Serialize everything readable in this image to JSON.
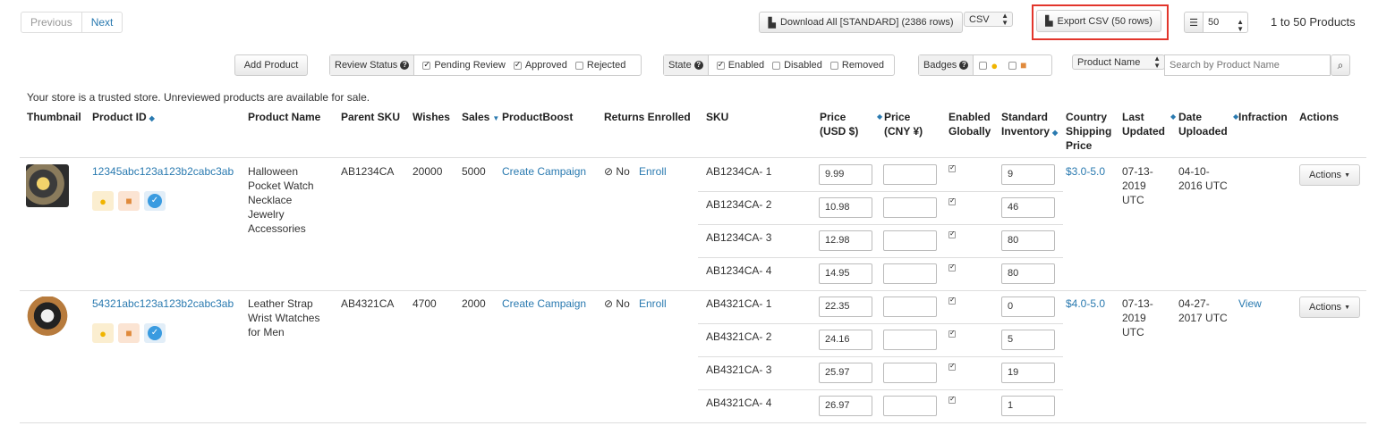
{
  "pager": {
    "previous": "Previous",
    "next": "Next"
  },
  "toolbar": {
    "download_all": "Download All [STANDARD] (2386 rows)",
    "format": "CSV",
    "export_csv": "Export CSV (50 rows)",
    "per_page": "50",
    "range_text": "1 to 50 Products",
    "highlight_color": "#e2352b"
  },
  "filters": {
    "add_product": "Add Product",
    "review_status": {
      "label": "Review Status",
      "options": [
        "Pending Review",
        "Approved",
        "Rejected"
      ],
      "checked": [
        true,
        true,
        false
      ]
    },
    "state": {
      "label": "State",
      "options": [
        "Enabled",
        "Disabled",
        "Removed"
      ],
      "checked": [
        true,
        false,
        false
      ]
    },
    "badges": {
      "label": "Badges"
    },
    "search_field": "Product Name",
    "search_placeholder": "Search by Product Name"
  },
  "notice": "Your store is a trusted store. Unreviewed products are available for sale.",
  "columns": {
    "thumbnail": "Thumbnail",
    "product_id": "Product ID",
    "product_name": "Product Name",
    "parent_sku": "Parent SKU",
    "wishes": "Wishes",
    "sales": "Sales",
    "productboost": "ProductBoost",
    "returns": "Returns Enrolled",
    "sku": "SKU",
    "price_usd_1": "Price",
    "price_usd_2": "(USD $)",
    "price_cny_1": "Price",
    "price_cny_2": "(CNY ¥)",
    "enabled_1": "Enabled",
    "enabled_2": "Globally",
    "inventory_1": "Standard",
    "inventory_2": "Inventory",
    "shipping_1": "Country",
    "shipping_2": "Shipping",
    "shipping_3": "Price",
    "updated_1": "Last",
    "updated_2": "Updated",
    "uploaded_1": "Date",
    "uploaded_2": "Uploaded",
    "infraction": "Infraction",
    "actions": "Actions"
  },
  "products": [
    {
      "id": "12345abc123a123b2cabc3ab",
      "name_lines": [
        "Halloween",
        "Pocket Watch",
        "Necklace",
        "Jewelry",
        "Accessories"
      ],
      "parent_sku": "AB1234CA",
      "wishes": "20000",
      "sales": "5000",
      "boost": "Create Campaign",
      "returns": "No",
      "enroll": "Enroll",
      "shipping": "$3.0-5.0",
      "updated": [
        "07-13-",
        "2019",
        "UTC"
      ],
      "uploaded": [
        "04-10-",
        "2016 UTC"
      ],
      "infraction": "",
      "actions": "Actions",
      "variants": [
        {
          "sku": "AB1234CA- 1",
          "price": "9.99",
          "inventory": "9"
        },
        {
          "sku": "AB1234CA- 2",
          "price": "10.98",
          "inventory": "46"
        },
        {
          "sku": "AB1234CA- 3",
          "price": "12.98",
          "inventory": "80"
        },
        {
          "sku": "AB1234CA- 4",
          "price": "14.95",
          "inventory": "80"
        }
      ]
    },
    {
      "id": "54321abc123a123b2cabc3ab",
      "name_lines": [
        "Leather Strap",
        "Wrist Wtatches",
        "for Men"
      ],
      "parent_sku": "AB4321CA",
      "wishes": "4700",
      "sales": "2000",
      "boost": "Create Campaign",
      "returns": "No",
      "enroll": "Enroll",
      "shipping": "$4.0-5.0",
      "updated": [
        "07-13-",
        "2019",
        "UTC"
      ],
      "uploaded": [
        "04-27-",
        "2017 UTC"
      ],
      "infraction": "View",
      "actions": "Actions",
      "variants": [
        {
          "sku": "AB4321CA- 1",
          "price": "22.35",
          "inventory": "0"
        },
        {
          "sku": "AB4321CA- 2",
          "price": "24.16",
          "inventory": "5"
        },
        {
          "sku": "AB4321CA- 3",
          "price": "25.97",
          "inventory": "19"
        },
        {
          "sku": "AB4321CA- 4",
          "price": "26.97",
          "inventory": "1"
        }
      ]
    }
  ]
}
